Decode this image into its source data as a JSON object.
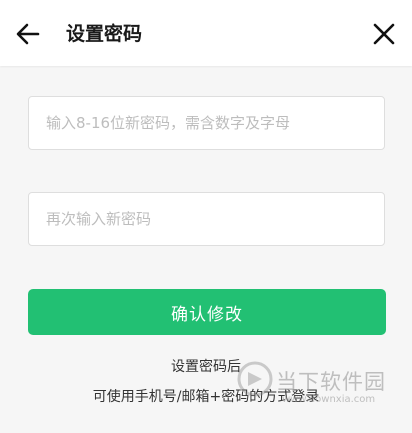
{
  "header": {
    "title": "设置密码"
  },
  "form": {
    "new_password": {
      "value": "",
      "placeholder": "输入8-16位新密码，需含数字及字母"
    },
    "repeat_password": {
      "value": "",
      "placeholder": "再次输入新密码"
    },
    "confirm_label": "确认修改"
  },
  "note": {
    "line1": "设置密码后",
    "line2": "可使用手机号/邮箱+密码的方式登录"
  },
  "watermark": {
    "name": "当下软件园",
    "url": "www.downxia.com"
  },
  "colors": {
    "accent": "#22c073",
    "background": "#f6f6f6"
  }
}
